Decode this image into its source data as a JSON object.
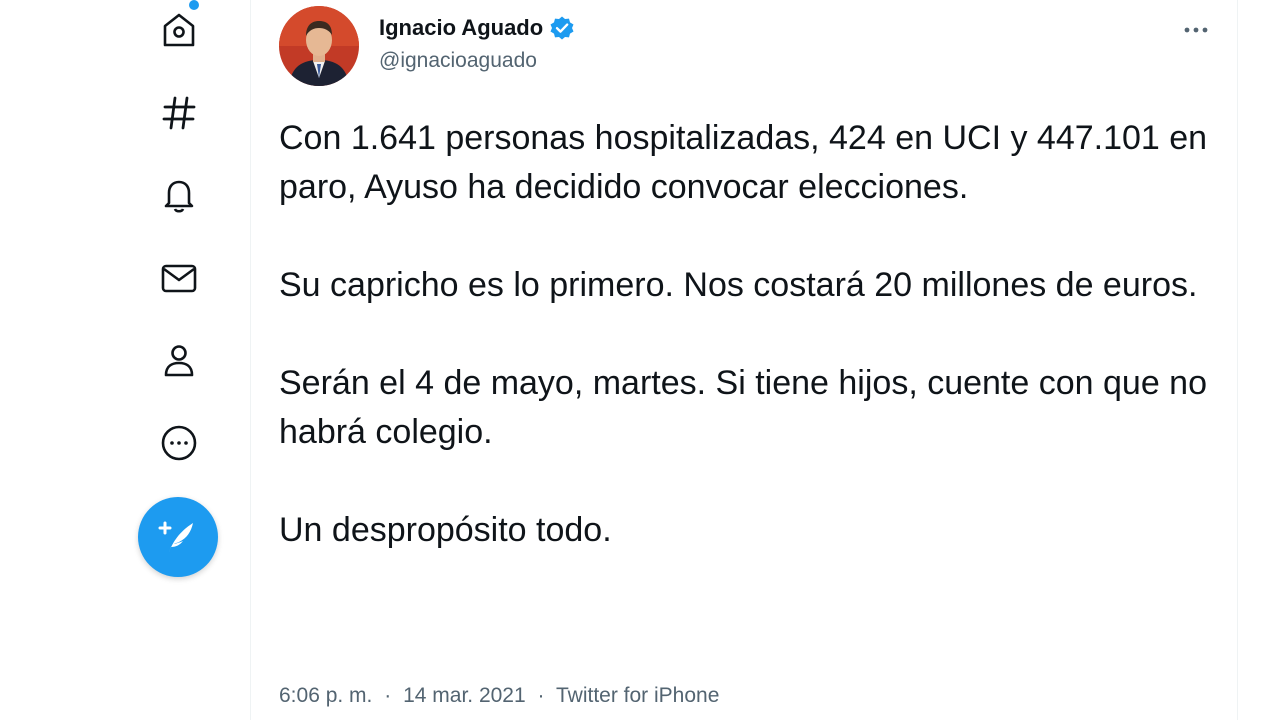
{
  "nav": {
    "items": [
      {
        "name": "home",
        "icon": "home-icon"
      },
      {
        "name": "explore",
        "icon": "hashtag-icon"
      },
      {
        "name": "notifications",
        "icon": "bell-icon"
      },
      {
        "name": "messages",
        "icon": "envelope-icon"
      },
      {
        "name": "profile",
        "icon": "person-icon"
      },
      {
        "name": "more",
        "icon": "more-circle-icon"
      }
    ],
    "compose_icon": "feather-plus-icon"
  },
  "tweet": {
    "author": {
      "name": "Ignacio Aguado",
      "handle": "@ignacioaguado",
      "verified": true
    },
    "paragraphs": [
      "Con 1.641 personas hospitalizadas, 424 en UCI y 447.101 en paro, Ayuso ha decidido convocar elecciones.",
      "Su capricho es lo primero. Nos costará 20 millones de euros.",
      "Serán el 4 de mayo, martes. Si tiene hijos, cuente con que no habrá colegio.",
      "Un despropósito todo."
    ],
    "time": "6:06 p. m.",
    "date": "14 mar. 2021",
    "source": "Twitter for iPhone",
    "separator": "·"
  },
  "colors": {
    "accent": "#1d9bf0",
    "text": "#0f1419",
    "secondary_text": "#536471",
    "border": "#eff3f4"
  }
}
